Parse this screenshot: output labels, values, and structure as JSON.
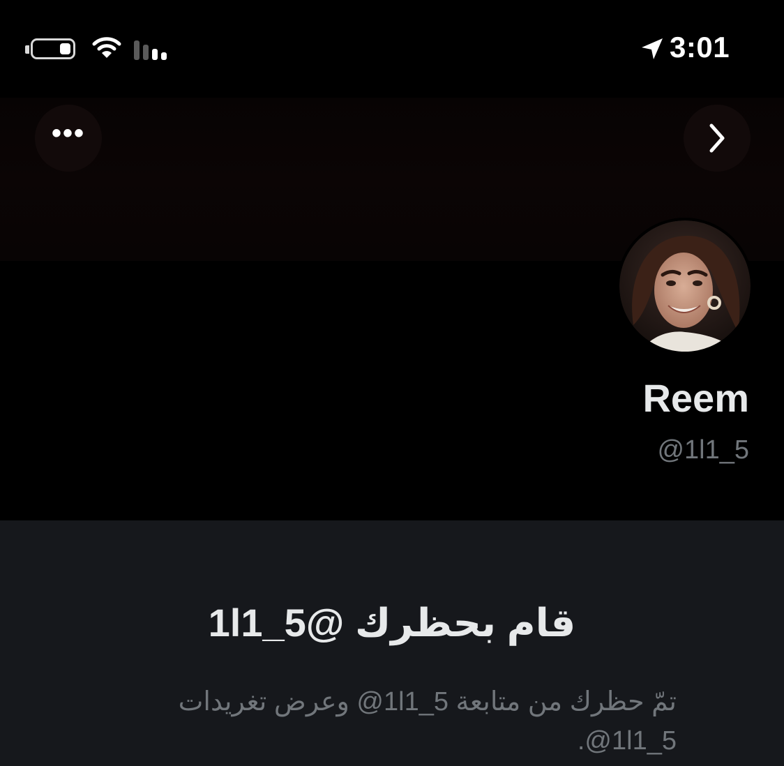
{
  "status_bar": {
    "time": "3:01",
    "battery_level": 0.3,
    "icons": [
      "battery-icon",
      "wifi-icon",
      "signal-icon",
      "location-arrow-icon"
    ]
  },
  "header": {
    "more_label": "•••",
    "icons": [
      "more-icon",
      "chevron-right-icon"
    ]
  },
  "profile": {
    "display_name": "Reem",
    "handle": "@1l1_5"
  },
  "blocked": {
    "title": "1l1_5@ قام بحظرك",
    "message": "تمّ حظرك من متابعة 1l1_5@ وعرض تغريدات 1l1_5@."
  },
  "colors": {
    "background": "#000000",
    "panel": "#16181c",
    "primary_text": "#e7e9ea",
    "secondary_text": "#71767b"
  }
}
